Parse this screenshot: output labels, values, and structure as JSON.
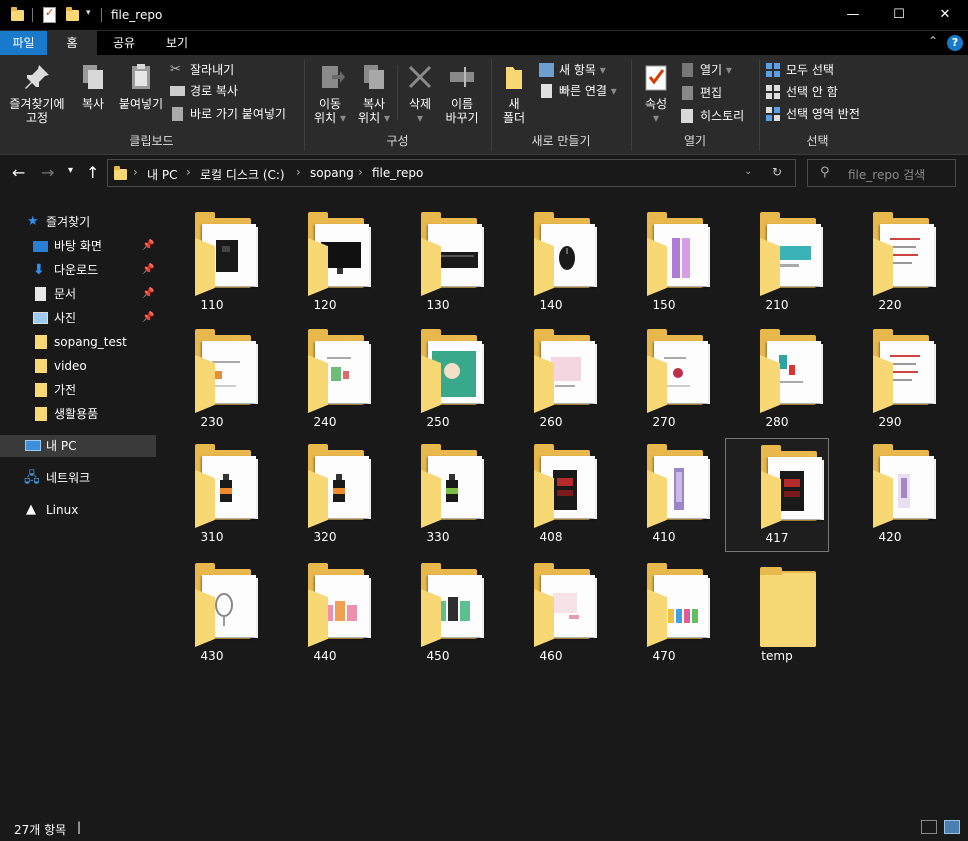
{
  "window": {
    "title": "file_repo",
    "minimize_glyph": "—",
    "maximize_glyph": "☐",
    "close_glyph": "✕"
  },
  "ribbon_tabs": {
    "file": "파일",
    "home": "홈",
    "share": "공유",
    "view": "보기"
  },
  "ribbon": {
    "clipboard": {
      "label": "클립보드",
      "pin_quick_access_1": "즐겨찾기에",
      "pin_quick_access_2": "고정",
      "copy": "복사",
      "paste": "붙여넣기",
      "cut": "잘라내기",
      "copy_path": "경로 복사",
      "paste_shortcut": "바로 가기 붙여넣기"
    },
    "organize": {
      "label": "구성",
      "move_to_1": "이동",
      "move_to_2": "위치",
      "copy_to_1": "복사",
      "copy_to_2": "위치",
      "delete": "삭제",
      "rename_1": "이름",
      "rename_2": "바꾸기"
    },
    "new": {
      "label": "새로 만들기",
      "new_folder_1": "새",
      "new_folder_2": "폴더",
      "new_item": "새 항목",
      "easy_access": "빠른 연결"
    },
    "open": {
      "label": "열기",
      "properties": "속성",
      "open": "열기",
      "edit": "편집",
      "history": "히스토리"
    },
    "select": {
      "label": "선택",
      "select_all": "모두 선택",
      "select_none": "선택 안 함",
      "invert_selection": "선택 영역 반전"
    }
  },
  "address": {
    "crumbs": [
      "내 PC",
      "로컬 디스크 (C:)",
      "sopang",
      "file_repo"
    ],
    "search_placeholder": "file_repo 검색"
  },
  "nav": {
    "quick_access": "즐겨찾기",
    "items": [
      {
        "label": "바탕 화면",
        "icon": "desktop-icon",
        "pinned": true
      },
      {
        "label": "다운로드",
        "icon": "download-icon",
        "pinned": true
      },
      {
        "label": "문서",
        "icon": "document-icon",
        "pinned": true
      },
      {
        "label": "사진",
        "icon": "pictures-icon",
        "pinned": true
      },
      {
        "label": "sopang_test",
        "icon": "folder-icon",
        "pinned": false
      },
      {
        "label": "video",
        "icon": "folder-icon",
        "pinned": false
      },
      {
        "label": "가전",
        "icon": "folder-icon",
        "pinned": false
      },
      {
        "label": "생활용품",
        "icon": "folder-icon",
        "pinned": false
      }
    ],
    "this_pc": "내 PC",
    "network": "네트워크",
    "linux": "Linux"
  },
  "folders": [
    {
      "name": "110",
      "thumb": "dark-tower"
    },
    {
      "name": "120",
      "thumb": "monitor"
    },
    {
      "name": "130",
      "thumb": "keyboard"
    },
    {
      "name": "140",
      "thumb": "mouse"
    },
    {
      "name": "150",
      "thumb": "purple-tall"
    },
    {
      "name": "210",
      "thumb": "teal-doc"
    },
    {
      "name": "220",
      "thumb": "red-list"
    },
    {
      "name": "230",
      "thumb": "doc-orange"
    },
    {
      "name": "240",
      "thumb": "doc-green"
    },
    {
      "name": "250",
      "thumb": "teal-poster"
    },
    {
      "name": "260",
      "thumb": "pink-doc"
    },
    {
      "name": "270",
      "thumb": "doc-red"
    },
    {
      "name": "280",
      "thumb": "teal-red-doc"
    },
    {
      "name": "290",
      "thumb": "red-list"
    },
    {
      "name": "310",
      "thumb": "bottle-orange"
    },
    {
      "name": "320",
      "thumb": "bottle-orange"
    },
    {
      "name": "330",
      "thumb": "bottle-green"
    },
    {
      "name": "408",
      "thumb": "dark-red"
    },
    {
      "name": "410",
      "thumb": "purple-strip"
    },
    {
      "name": "417",
      "thumb": "dark-red"
    },
    {
      "name": "420",
      "thumb": "purple-doc"
    },
    {
      "name": "430",
      "thumb": "mirror"
    },
    {
      "name": "440",
      "thumb": "pink-bottles"
    },
    {
      "name": "450",
      "thumb": "teal-bottles"
    },
    {
      "name": "460",
      "thumb": "pink-sparse"
    },
    {
      "name": "470",
      "thumb": "color-bottles"
    },
    {
      "name": "temp",
      "thumb": "empty"
    }
  ],
  "selected_folder": "417",
  "status": {
    "item_count": "27개 항목"
  },
  "colors": {
    "accent": "#1979ca",
    "folder": "#f8d775",
    "folder_dark": "#e8b84c",
    "background": "#191919",
    "ribbon": "#2b2b2b"
  }
}
